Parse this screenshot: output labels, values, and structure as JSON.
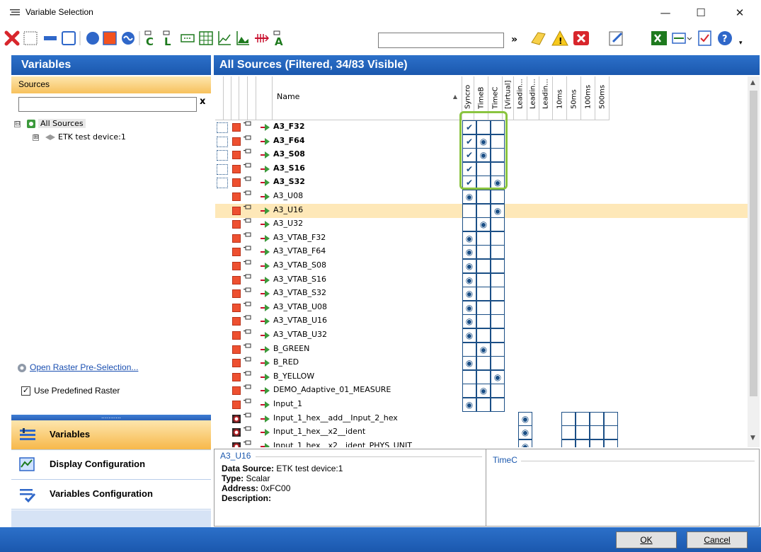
{
  "window": {
    "title": "Variable Selection",
    "minimize": "—",
    "maximize": "☐",
    "close": "✕"
  },
  "toolbar": {
    "search_value": "",
    "overflow": "»"
  },
  "left_panel": {
    "header": "Variables",
    "sources_header": "Sources",
    "filter_value": "",
    "clear": "x",
    "tree": [
      {
        "label": "All Sources",
        "expander": "⊟"
      },
      {
        "label": "ETK test device:1",
        "expander": "⊞"
      }
    ],
    "raster_link": "Open Raster Pre-Selection...",
    "use_predefined": {
      "label": "Use Predefined Raster",
      "checked": true,
      "mark": "✓"
    },
    "splitter": "...........",
    "nav": [
      {
        "label": "Variables",
        "icon": "variables-icon",
        "selected": true
      },
      {
        "label": "Display Configuration",
        "icon": "display-config-icon",
        "selected": false
      },
      {
        "label": "Variables Configuration",
        "icon": "variables-config-icon",
        "selected": false
      }
    ]
  },
  "grid": {
    "header": "All Sources (Filtered, 34/83 Visible)",
    "name_col": "Name",
    "sort_glyph": "▲",
    "rate_cols": [
      "Syncro",
      "TimeB",
      "TimeC",
      "[Virtual]",
      "Leadin...",
      "Leadin...",
      "Leadin...",
      "10ms",
      "50ms",
      "100ms",
      "500ms"
    ],
    "rows": [
      {
        "name": "A3_F32",
        "bold": true,
        "cells": [
          "✔",
          "",
          ""
        ]
      },
      {
        "name": "A3_F64",
        "bold": true,
        "cells": [
          "✔",
          "◉",
          ""
        ]
      },
      {
        "name": "A3_S08",
        "bold": true,
        "cells": [
          "✔",
          "◉",
          ""
        ]
      },
      {
        "name": "A3_S16",
        "bold": true,
        "cells": [
          "✔",
          "",
          ""
        ]
      },
      {
        "name": "A3_S32",
        "bold": true,
        "cells": [
          "✔",
          "",
          "◉"
        ]
      },
      {
        "name": "A3_U08",
        "bold": false,
        "cells": [
          "◉",
          "",
          ""
        ]
      },
      {
        "name": "A3_U16",
        "bold": false,
        "cells": [
          "",
          "",
          "◉"
        ],
        "selected": true
      },
      {
        "name": "A3_U32",
        "bold": false,
        "cells": [
          "",
          "◉",
          ""
        ]
      },
      {
        "name": "A3_VTAB_F32",
        "bold": false,
        "cells": [
          "◉",
          "",
          ""
        ]
      },
      {
        "name": "A3_VTAB_F64",
        "bold": false,
        "cells": [
          "◉",
          "",
          ""
        ]
      },
      {
        "name": "A3_VTAB_S08",
        "bold": false,
        "cells": [
          "◉",
          "",
          ""
        ]
      },
      {
        "name": "A3_VTAB_S16",
        "bold": false,
        "cells": [
          "◉",
          "",
          ""
        ]
      },
      {
        "name": "A3_VTAB_S32",
        "bold": false,
        "cells": [
          "◉",
          "",
          ""
        ]
      },
      {
        "name": "A3_VTAB_U08",
        "bold": false,
        "cells": [
          "◉",
          "",
          ""
        ]
      },
      {
        "name": "A3_VTAB_U16",
        "bold": false,
        "cells": [
          "◉",
          "",
          ""
        ]
      },
      {
        "name": "A3_VTAB_U32",
        "bold": false,
        "cells": [
          "◉",
          "",
          ""
        ]
      },
      {
        "name": "B_GREEN",
        "bold": false,
        "cells": [
          "",
          "◉",
          ""
        ]
      },
      {
        "name": "B_RED",
        "bold": false,
        "cells": [
          "◉",
          "",
          ""
        ]
      },
      {
        "name": "B_YELLOW",
        "bold": false,
        "cells": [
          "",
          "",
          "◉"
        ]
      },
      {
        "name": "DEMO_Adaptive_01_MEASURE",
        "bold": false,
        "cells": [
          "",
          "◉",
          ""
        ]
      },
      {
        "name": "Input_1",
        "bold": false,
        "cells": [
          "◉",
          "",
          ""
        ]
      },
      {
        "name": "Input_1_hex__add__Input_2_hex",
        "bold": false,
        "virtual": true
      },
      {
        "name": "Input_1_hex__x2__ident",
        "bold": false,
        "virtual": true
      },
      {
        "name": "Input_1_hex__x2__ident_PHYS_UNIT",
        "bold": false,
        "virtual": true
      }
    ]
  },
  "detail": {
    "title": "A3_U16",
    "fields": [
      {
        "label": "Data Source:",
        "value": " ETK test device:1"
      },
      {
        "label": "Type:",
        "value": " Scalar"
      },
      {
        "label": "Address:",
        "value": " 0xFC00"
      },
      {
        "label": "Description:",
        "value": ""
      }
    ],
    "right_title": "TimeC"
  },
  "buttons": {
    "ok": "OK",
    "cancel": "Cancel"
  },
  "colors": {
    "accent": "#1b58ae",
    "highlight": "#8ac43f",
    "selected_row": "#fee8b8"
  }
}
